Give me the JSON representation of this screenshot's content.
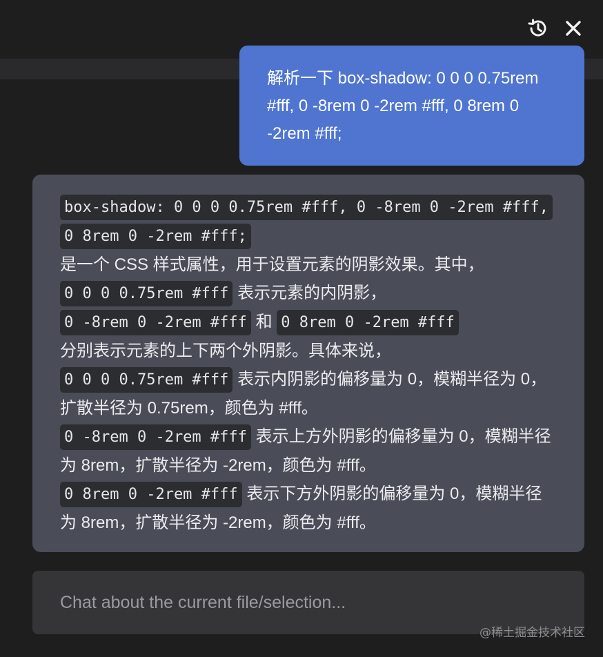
{
  "header": {
    "history_icon": "history-icon",
    "close_icon": "close-icon"
  },
  "user_message": {
    "text": "解析一下 box-shadow: 0 0 0 0.75rem #fff, 0 -8rem 0 -2rem #fff, 0 8rem 0 -2rem #fff;"
  },
  "assistant_message": {
    "code_full": "box-shadow: 0 0 0 0.75rem #fff, 0 -8rem 0 -2rem #fff, 0 8rem 0 -2rem #fff;",
    "intro": "是一个 CSS 样式属性，用于设置元素的阴影效果。其中，",
    "code_inner": "0 0 0 0.75rem #fff",
    "inner_desc": "表示元素的内阴影，",
    "code_top": "0 -8rem 0 -2rem #fff",
    "and": "和",
    "code_bottom": "0 8rem 0 -2rem #fff",
    "outer_desc": "分别表示元素的上下两个外阴影。具体来说，",
    "inner_detail": "表示内阴影的偏移量为 0，模糊半径为 0，扩散半径为 0.75rem，颜色为 #fff。",
    "top_detail": "表示上方外阴影的偏移量为 0，模糊半径为 8rem，扩散半径为 -2rem，颜色为 #fff。",
    "bottom_detail": "表示下方外阴影的偏移量为 0，模糊半径为 8rem，扩散半径为 -2rem，颜色为 #fff。"
  },
  "chat_input": {
    "placeholder": "Chat about the current file/selection...",
    "value": ""
  },
  "watermark": "@稀土掘金技术社区",
  "colors": {
    "background": "#1e1e1f",
    "user_bubble": "#4f75d1",
    "assistant_bubble": "#4a4d58",
    "code_background": "#2c2d31",
    "input_background": "#353538"
  }
}
